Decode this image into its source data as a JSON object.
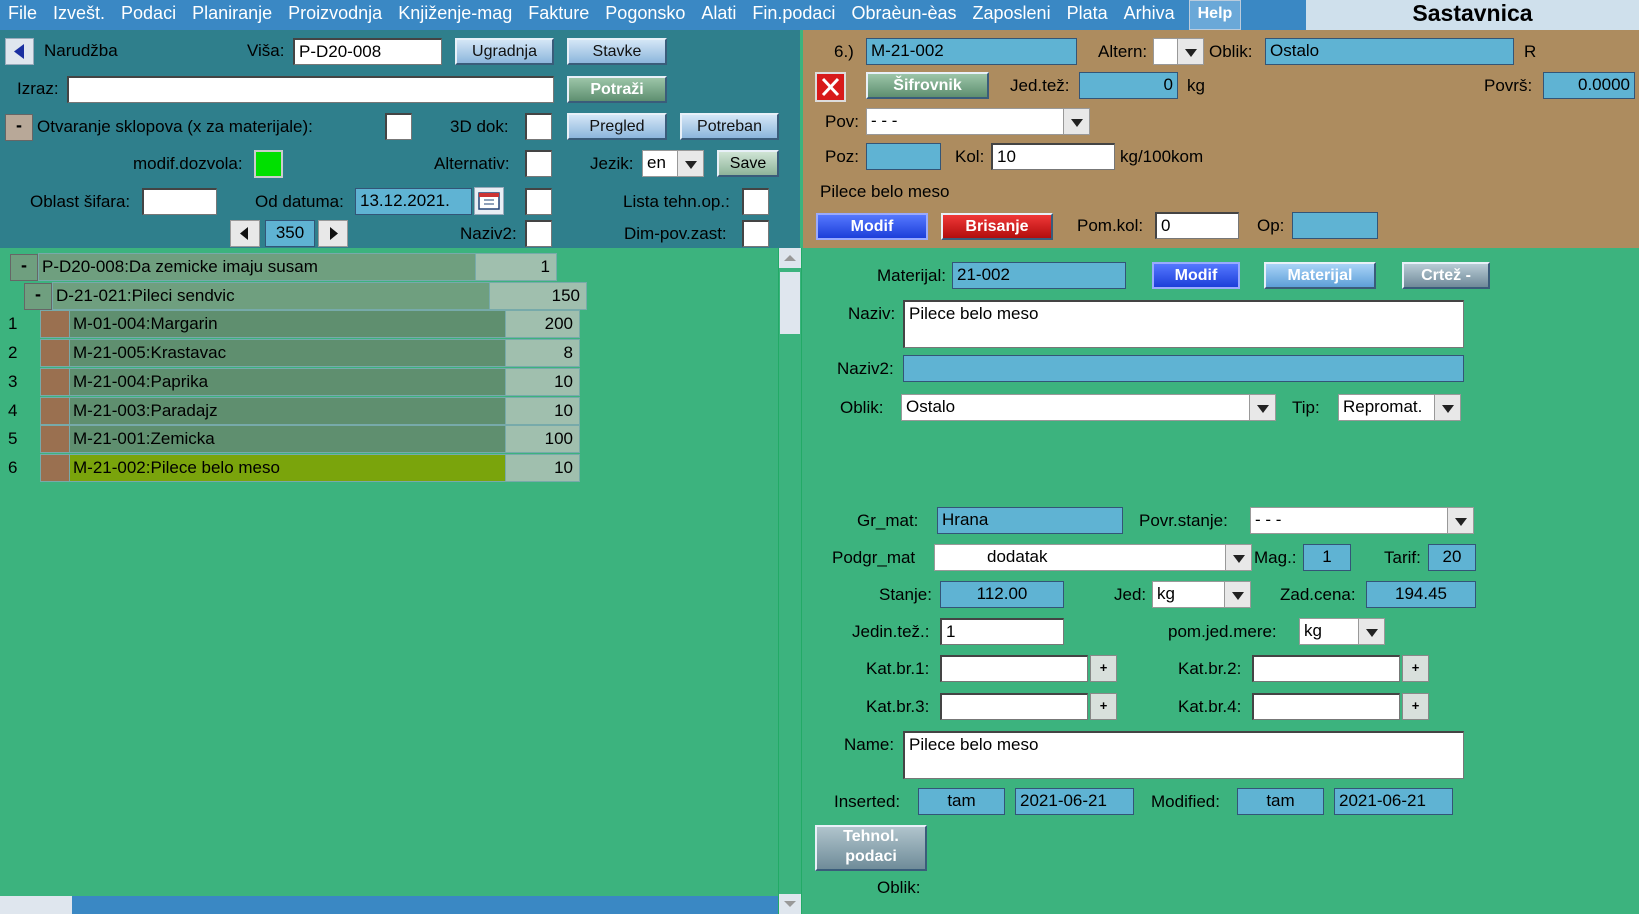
{
  "menu": [
    "File",
    "Izvešt.",
    "Podaci",
    "Planiranje",
    "Proizvodnja",
    "Knjiženje-mag",
    "Fakture",
    "Pogonsko",
    "Alati",
    "Fin.podaci",
    "Obraèun-èas",
    "Zaposleni",
    "Plata",
    "Arhiva"
  ],
  "help_label": "Help",
  "window_title": "Sastavnica",
  "left": {
    "narudzba_label": "Narudžba",
    "visa_label": "Viša:",
    "visa_value": "P-D20-008",
    "ugradnja_label": "Ugradnja",
    "stavke_label": "Stavke",
    "izraz_label": "Izraz:",
    "izraz_value": "",
    "potrazi_label": "Potraži",
    "otvaranje_label": "Otvaranje sklopova (x za materijale):",
    "dok3d_label": "3D dok:",
    "pregled_label": "Pregled",
    "potreban_label": "Potreban",
    "modif_label": "modif.dozvola:",
    "alternativ_label": "Alternativ:",
    "jezik_label": "Jezik:",
    "jezik_value": "en",
    "save_label": "Save",
    "oblast_label": "Oblast šifara:",
    "od_datuma_label": "Od datuma:",
    "od_datuma_value": "13.12.2021.",
    "lista_label": "Lista tehn.op.:",
    "page_value": "350",
    "naziv2_label": "Naziv2:",
    "dimpov_label": "Dim-pov.zast:"
  },
  "tree": {
    "root": {
      "name": "P-D20-008:Da zemicke imaju susam",
      "value": "1"
    },
    "child": {
      "name": "D-21-021:Pileci sendvic",
      "value": "150"
    },
    "items": [
      {
        "num": "1",
        "name": "M-01-004:Margarin",
        "value": "200"
      },
      {
        "num": "2",
        "name": "M-21-005:Krastavac",
        "value": "8"
      },
      {
        "num": "3",
        "name": "M-21-004:Paprika",
        "value": "10"
      },
      {
        "num": "4",
        "name": "M-21-003:Paradajz",
        "value": "10"
      },
      {
        "num": "5",
        "name": "M-21-001:Zemicka",
        "value": "100"
      },
      {
        "num": "6",
        "name": "M-21-002:Pilece belo meso",
        "value": "10"
      }
    ]
  },
  "right_top": {
    "index_label": "6.)",
    "code_value": "M-21-002",
    "altern_label": "Altern:",
    "oblik_label": "Oblik:",
    "oblik_value": "Ostalo",
    "r_label": "R",
    "sifrovnik_label": "Šifrovnik",
    "jedtez_label": "Jed.tež:",
    "jedtez_value": "0",
    "kg_label": "kg",
    "povrs_label": "Površ:",
    "povrs_value": "0.0000",
    "pov_label": "Pov:",
    "pov_value": "- - -",
    "poz_label": "Poz:",
    "kol_label": "Kol:",
    "kol_value": "10",
    "kgper_label": "kg/100kom",
    "material_name": "Pilece belo meso",
    "modif_label": "Modif",
    "brisanje_label": "Brisanje",
    "pomkol_label": "Pom.kol:",
    "pomkol_value": "0",
    "op_label": "Op:"
  },
  "detail": {
    "materijal_label": "Materijal:",
    "materijal_value": "21-002",
    "modif_label": "Modif",
    "materijal_btn": "Materijal",
    "crtez_btn": "Crtež -",
    "naziv_label": "Naziv:",
    "naziv_value": "Pilece belo meso",
    "naziv2_label": "Naziv2:",
    "oblik_label": "Oblik:",
    "oblik_value": "Ostalo",
    "tip_label": "Tip:",
    "tip_value": "Repromat.",
    "grmat_label": "Gr_mat:",
    "grmat_value": "Hrana",
    "povrstanje_label": "Povr.stanje:",
    "povrstanje_value": "- - -",
    "podgr_label": "Podgr_mat",
    "podgr_value": "dodatak",
    "mag_label": "Mag.:",
    "mag_value": "1",
    "tarif_label": "Tarif:",
    "tarif_value": "20",
    "stanje_label": "Stanje:",
    "stanje_value": "112.00",
    "jed_label": "Jed:",
    "jed_value": "kg",
    "zadcena_label": "Zad.cena:",
    "zadcena_value": "194.45",
    "jedintez_label": "Jedin.tež.:",
    "jedintez_value": "1",
    "pomjed_label": "pom.jed.mere:",
    "pomjed_value": "kg",
    "katbr1_label": "Kat.br.1:",
    "katbr2_label": "Kat.br.2:",
    "katbr3_label": "Kat.br.3:",
    "katbr4_label": "Kat.br.4:",
    "plus": "+",
    "name_label": "Name:",
    "name_value": "Pilece belo meso",
    "inserted_label": "Inserted:",
    "inserted_user": "tam",
    "inserted_date": "2021-06-21",
    "modified_label": "Modified:",
    "modified_user": "tam",
    "modified_date": "2021-06-21",
    "tehnol_line1": "Tehnol.",
    "tehnol_line2": "podaci",
    "oblik2_label": "Oblik:"
  },
  "colors": {
    "background": "#3cb37e",
    "left_panel": "#2f7f8c",
    "right_panel": "#ad8c5f",
    "menubar": "#3a88c4",
    "selected_row": "#7aa40c",
    "modif_indicator": "#00e000"
  }
}
